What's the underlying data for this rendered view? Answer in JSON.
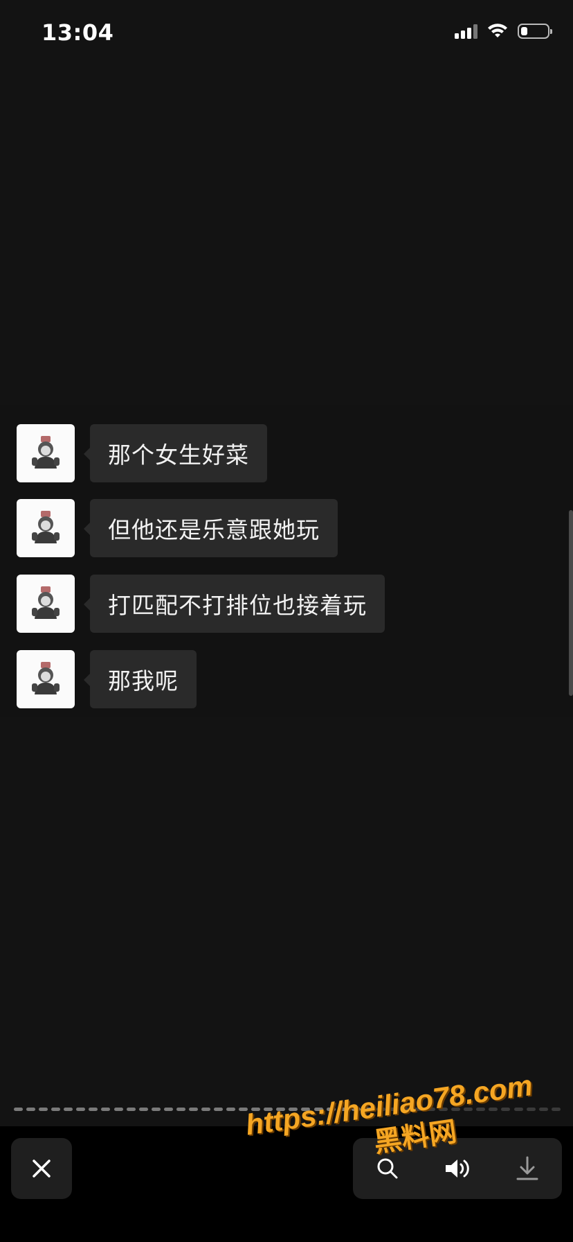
{
  "status_bar": {
    "time": "13:04",
    "signal_icon": "cellular-signal-icon",
    "wifi_icon": "wifi-icon",
    "battery_icon": "battery-icon",
    "battery_level": 0.25
  },
  "chat": {
    "messages": [
      {
        "text": "那个女生好菜",
        "avatar_icon": "avatar-image"
      },
      {
        "text": "但他还是乐意跟她玩",
        "avatar_icon": "avatar-image"
      },
      {
        "text": "打匹配不打排位也接着玩",
        "avatar_icon": "avatar-image"
      },
      {
        "text": "那我呢",
        "avatar_icon": "avatar-image"
      }
    ]
  },
  "playback": {
    "progress": 0.65
  },
  "toolbar": {
    "close_icon": "close-icon",
    "search_icon": "search-icon",
    "volume_icon": "volume-icon",
    "download_icon": "download-icon"
  },
  "watermark": {
    "url": "https://heiliao78.com",
    "text": "黑料网"
  },
  "colors": {
    "background": "#131313",
    "bubble": "#2a2a2a",
    "watermark": "#f5a623"
  }
}
